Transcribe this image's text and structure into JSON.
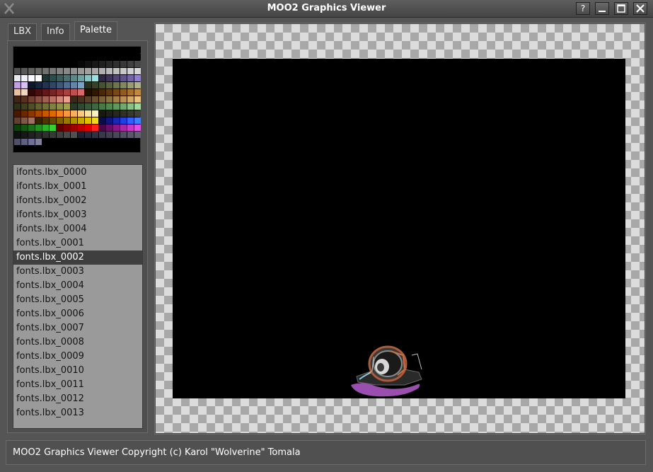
{
  "window": {
    "title": "MOO2 Graphics Viewer",
    "buttons": {
      "help": "?"
    }
  },
  "tabs": [
    {
      "label": "LBX",
      "active": false
    },
    {
      "label": "Info",
      "active": false
    },
    {
      "label": "Palette",
      "active": true
    }
  ],
  "palette_colors": [
    "#000000",
    "#000000",
    "#000000",
    "#000000",
    "#000000",
    "#000000",
    "#000000",
    "#000000",
    "#000000",
    "#000000",
    "#000000",
    "#000000",
    "#000000",
    "#000000",
    "#000000",
    "#000000",
    "#000000",
    "#000000",
    "#000000",
    "#000000",
    "#000000",
    "#000000",
    "#000000",
    "#000000",
    "#000000",
    "#000000",
    "#000000",
    "#000000",
    "#000000",
    "#000000",
    "#000000",
    "#000000",
    "#000000",
    "#000000",
    "#000000",
    "#000000",
    "#000000",
    "#000000",
    "#000000",
    "#000000",
    "#000000",
    "#000000",
    "#000000",
    "#000000",
    "#000000",
    "#080808",
    "#101010",
    "#181818",
    "#202020",
    "#282828",
    "#303030",
    "#383838",
    "#404040",
    "#484848",
    "#505050",
    "#585858",
    "#606060",
    "#686868",
    "#707070",
    "#787878",
    "#808080",
    "#888888",
    "#909090",
    "#989898",
    "#a0a0a0",
    "#a8a8a8",
    "#b0b0b0",
    "#b8b8b8",
    "#c0c0c0",
    "#c8c8c8",
    "#d0d0d0",
    "#d8d8d8",
    "#e8e8f0",
    "#f0f0f8",
    "#f8f8ff",
    "#ffffff",
    "#1c3434",
    "#2c4c4c",
    "#3c5c5c",
    "#4c7070",
    "#5c8888",
    "#70a0a0",
    "#88c0c0",
    "#a0e0e0",
    "#302840",
    "#403458",
    "#504470",
    "#605488",
    "#7464a8",
    "#9080c8",
    "#c0a0e0",
    "#d8c0f0",
    "#101828",
    "#18243c",
    "#243450",
    "#304464",
    "#405878",
    "#506c90",
    "#6484a8",
    "#7ca0c0",
    "#283020",
    "#384028",
    "#485034",
    "#586040",
    "#6c7450",
    "#808860",
    "#989c74",
    "#b0b08c",
    "#e8c0a0",
    "#f0d8c0",
    "#300808",
    "#481010",
    "#601818",
    "#782424",
    "#903030",
    "#a84040",
    "#c05050",
    "#d86868",
    "#201000",
    "#301800",
    "#482808",
    "#603810",
    "#784818",
    "#905c24",
    "#a87030",
    "#c08840",
    "#402418",
    "#583020",
    "#704030",
    "#885040",
    "#a06050",
    "#b87060",
    "#d08878",
    "#e8a090",
    "#382818",
    "#483020",
    "#584028",
    "#685030",
    "#786038",
    "#887040",
    "#a08048",
    "#b89058",
    "#d0a868",
    "#e8c080",
    "#303018",
    "#404020",
    "#505028",
    "#606030",
    "#707038",
    "#808040",
    "#909048",
    "#a0a050",
    "#283828",
    "#304830",
    "#385838",
    "#406840",
    "#487848",
    "#508850",
    "#609860",
    "#70a870",
    "#88c088",
    "#a0d8a0",
    "#481800",
    "#682800",
    "#883800",
    "#a84800",
    "#c85800",
    "#e06800",
    "#f08020",
    "#f89840",
    "#f8b060",
    "#f8c880",
    "#f8e0a0",
    "#f8f0c0",
    "#181810",
    "#202018",
    "#282820",
    "#303028",
    "#383830",
    "#404038",
    "#604030",
    "#805848",
    "#a07060",
    "#382400",
    "#503400",
    "#684800",
    "#806000",
    "#987800",
    "#b09000",
    "#c8a800",
    "#e0c000",
    "#f0d820",
    "#0c0c48",
    "#101880",
    "#1828b0",
    "#2040e0",
    "#3060ff",
    "#4080ff",
    "#0c400c",
    "#145814",
    "#1c701c",
    "#249024",
    "#2cb02c",
    "#34d034",
    "#600000",
    "#800000",
    "#a00000",
    "#c00000",
    "#e00000",
    "#ff2020",
    "#480848",
    "#681068",
    "#881888",
    "#a828a8",
    "#c838c8",
    "#e050e0",
    "#101010",
    "#181818",
    "#202020",
    "#282828",
    "#303030",
    "#383838",
    "#404040",
    "#484848",
    "#505050",
    "#202030",
    "#282838",
    "#303040",
    "#383848",
    "#404050",
    "#484858",
    "#505060",
    "#585868",
    "#606070",
    "#505068",
    "#606080",
    "#707098",
    "#808098",
    "#000000"
  ],
  "file_list": {
    "items": [
      "ifonts.lbx_0000",
      "ifonts.lbx_0001",
      "ifonts.lbx_0002",
      "ifonts.lbx_0003",
      "ifonts.lbx_0004",
      "fonts.lbx_0001",
      "fonts.lbx_0002",
      "fonts.lbx_0003",
      "fonts.lbx_0004",
      "fonts.lbx_0005",
      "fonts.lbx_0006",
      "fonts.lbx_0007",
      "fonts.lbx_0008",
      "fonts.lbx_0009",
      "fonts.lbx_0010",
      "fonts.lbx_0011",
      "fonts.lbx_0012",
      "fonts.lbx_0013"
    ],
    "selected_index": 6
  },
  "status": {
    "text": "MOO2 Graphics Viewer Copyright (c) Karol \"Wolverine\" Tomala"
  },
  "colors": {
    "window_bg": "#555555",
    "list_bg": "#9a9a9a",
    "selection_bg": "#3f3f3f",
    "sprite_accent": "#9a4fb0"
  }
}
